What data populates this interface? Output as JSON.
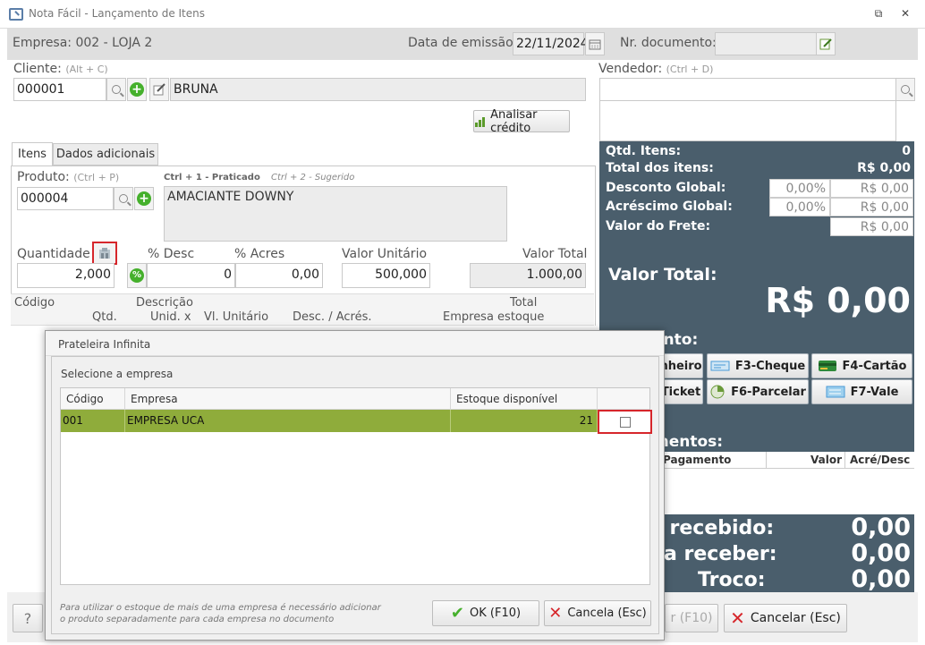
{
  "window": {
    "title": "Nota Fácil - Lançamento de Itens"
  },
  "header": {
    "empresa": "Empresa: 002 - LOJA 2",
    "data_emissao_label": "Data de emissão:",
    "data_emissao_value": "22/11/2024",
    "nr_documento_label": "Nr. documento:",
    "nr_documento_value": ""
  },
  "cliente": {
    "label": "Cliente:",
    "hint": "(Alt + C)",
    "code": "000001",
    "name": "BRUNA"
  },
  "vendedor": {
    "label": "Vendedor:",
    "hint": "(Ctrl + D)",
    "value": ""
  },
  "analisar_credito": "Analisar crédito",
  "tabs": [
    {
      "label": "Itens"
    },
    {
      "label": "Dados adicionais"
    }
  ],
  "produto": {
    "label": "Produto:",
    "hint": "(Ctrl + P)",
    "code": "000004",
    "description": "AMACIANTE DOWNY",
    "hint_praticado": "Ctrl + 1 - Praticado",
    "hint_sugerido": "Ctrl + 2 - Sugerido"
  },
  "item_fields": {
    "quantidade_label": "Quantidade",
    "quantidade_value": "2,000",
    "desc_label": "% Desc",
    "desc_value": "0",
    "acres_label": "% Acres",
    "acres_value": "0,00",
    "valor_unitario_label": "Valor Unitário",
    "valor_unitario_value": "500,000",
    "valor_total_label": "Valor Total",
    "valor_total_value": "1.000,00"
  },
  "items_table": {
    "row1": {
      "codigo": "Código",
      "descricao": "Descrição",
      "total": "Total"
    },
    "row2": {
      "qtd": "Qtd.",
      "unid": "Unid. x",
      "vl_unitario": "Vl. Unitário",
      "desc_acres": "Desc. / Acrés.",
      "empresa_estoque": "Empresa estoque"
    }
  },
  "summary": {
    "qtd_itens_label": "Qtd. Itens:",
    "qtd_itens_value": "0",
    "total_itens_label": "Total dos itens:",
    "total_itens_value": "R$ 0,00",
    "desconto_label": "Desconto Global:",
    "desconto_pct": "0,00%",
    "desconto_value": "R$ 0,00",
    "acrescimo_label": "Acréscimo Global:",
    "acrescimo_pct": "0,00%",
    "acrescimo_value": "R$ 0,00",
    "frete_label": "Valor do Frete:",
    "frete_value": "R$ 0,00",
    "valor_total_label": "Valor Total:",
    "valor_total_value": "R$ 0,00"
  },
  "payment": {
    "section_label": "ento:",
    "buttons": [
      "nheiro",
      "F3-Cheque",
      "F4-Cartão",
      "Ticket",
      "F6-Parcelar",
      "F7-Vale"
    ],
    "list_label": "mentos:",
    "cols": {
      "pagamento": "Pagamento",
      "valor": "Valor",
      "acre_desc": "Acré/Desc"
    },
    "recebido_label": "r recebido:",
    "recebido_value": "0,00",
    "receber_label": "a receber:",
    "receber_value": "0,00",
    "troco_label": "Troco:",
    "troco_value": "0,00"
  },
  "footer": {
    "help": "?",
    "confirm_partial": "r (F10)",
    "cancel": "Cancelar (Esc)"
  },
  "modal": {
    "title": "Prateleira Infinita",
    "subtitle": "Selecione a empresa",
    "cols": {
      "codigo": "Código",
      "empresa": "Empresa",
      "estoque": "Estoque disponível"
    },
    "rows": [
      {
        "codigo": "001",
        "empresa": "EMPRESA UCA",
        "estoque": "21",
        "checked": false
      }
    ],
    "note": "Para utilizar o estoque de mais de uma empresa é necessário adicionar o produto separadamente para cada empresa no documento",
    "ok": "OK (F10)",
    "cancel": "Cancela (Esc)"
  },
  "colors": {
    "panel": "#4a5e6c",
    "row_selected": "#8fac3b",
    "highlight": "#d6262b",
    "green": "#45b02c"
  }
}
